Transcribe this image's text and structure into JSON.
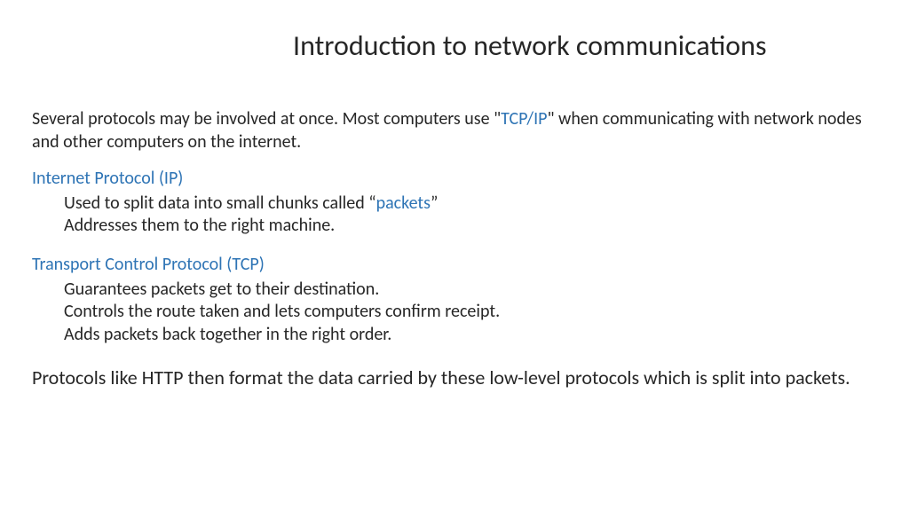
{
  "title": "Introduction to network communications",
  "intro": {
    "pre": "Several protocols may be involved at once. Most computers use \"",
    "link": "TCP/IP",
    "post": "\" when communicating with network nodes and other computers on the internet."
  },
  "ip": {
    "heading": "Internet Protocol (IP)",
    "line1_pre": "Used to split data into small chunks called “",
    "line1_link": "packets",
    "line1_post": "”",
    "line2": "Addresses them to the right machine."
  },
  "tcp": {
    "heading": "Transport Control Protocol (TCP)",
    "line1": "Guarantees packets get to their destination.",
    "line2": "Controls the route taken and lets computers confirm receipt.",
    "line3": "Adds packets back together in the right order."
  },
  "closing": "Protocols like HTTP then format the data carried by these low-level protocols which is split into packets."
}
